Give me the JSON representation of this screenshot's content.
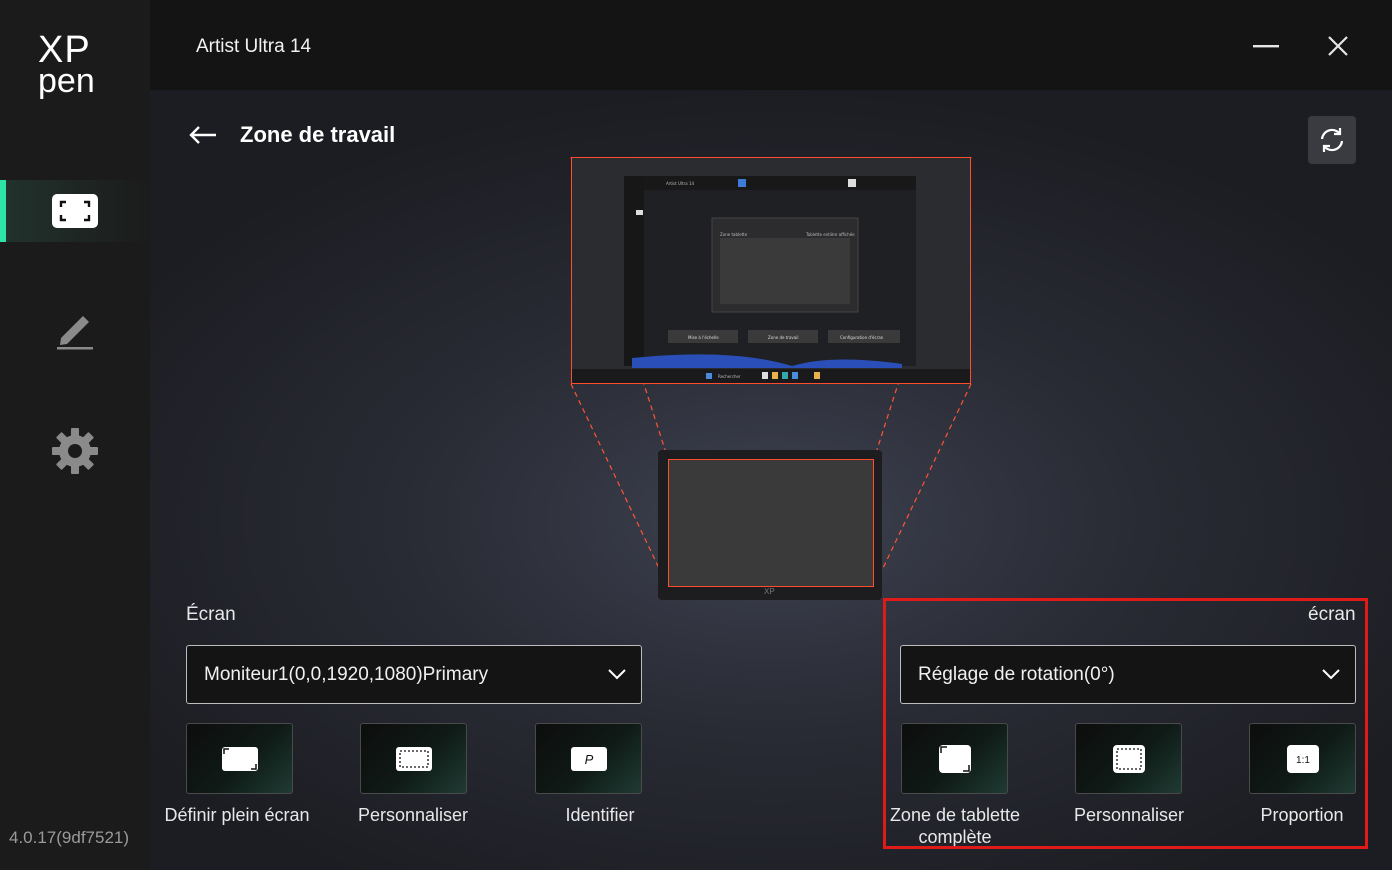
{
  "app": {
    "title": "Artist Ultra 14",
    "version": "4.0.17(9df7521)"
  },
  "brand": {
    "logo_top": "XP",
    "logo_bottom": "pen",
    "accent": "#2ee3a6"
  },
  "sidebar": {
    "items": [
      {
        "name": "workarea",
        "icon": "workarea-frame-icon",
        "active": true
      },
      {
        "name": "pen",
        "icon": "pen-icon",
        "active": false
      },
      {
        "name": "settings",
        "icon": "gear-icon",
        "active": false
      }
    ]
  },
  "header": {
    "page_title": "Zone de travail"
  },
  "screen_section": {
    "label": "Écran",
    "dropdown_value": "Moniteur1(0,0,1920,1080)Primary",
    "buttons": [
      {
        "label": "Définir plein écran",
        "icon": "full-screen-icon"
      },
      {
        "label": "Personnaliser",
        "icon": "custom-area-icon"
      },
      {
        "label": "Identifier",
        "icon": "identify-icon",
        "glyph": "P"
      }
    ]
  },
  "tablet_section": {
    "label": "écran",
    "dropdown_value": "Réglage de rotation(0°)",
    "buttons": [
      {
        "label": "Zone de tablette complète",
        "icon": "full-tablet-icon"
      },
      {
        "label": "Personnaliser",
        "icon": "custom-area-icon"
      },
      {
        "label": "Proportion",
        "icon": "proportion-icon",
        "glyph": "1:1"
      }
    ]
  },
  "preview": {
    "mini_title": "Artist Ultra 14",
    "mini_left": "Zone tablette",
    "mini_right": "Tablette entière affichée",
    "mini_buttons": [
      "Mise à l'échelle",
      "Zone de travail",
      "Configuration d'écran"
    ],
    "mini_search": "Rechercher"
  },
  "colors": {
    "outline": "#ff4d2e",
    "highlight": "#e01919"
  }
}
